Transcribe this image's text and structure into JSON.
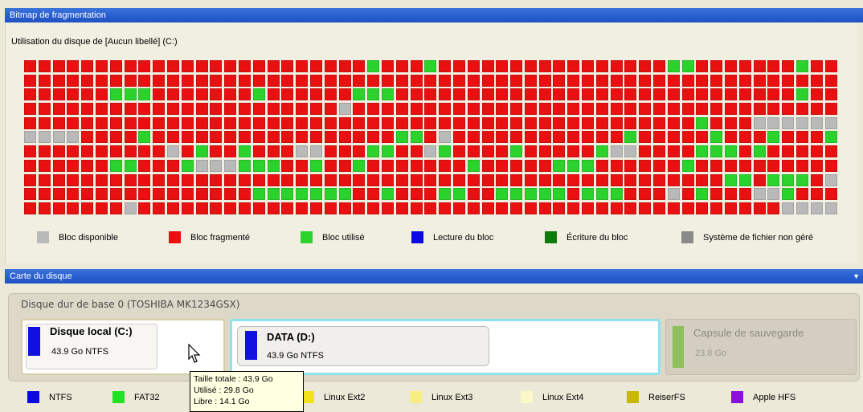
{
  "fragmentation_panel": {
    "title": "Bitmap de fragmentation",
    "disk_caption": "Utilisation du disque de [Aucun libellé] (C:)",
    "bitmap_rows": [
      "rrrrrrrrrrrrrrrrrrrrrrrrgrrrgrrrrrrrrrrrrrrrrggrrrrrrrgrrr",
      "rrrrrrrrrrrrrrrrrrrrrrrrrrrrrrrrrrrrrrrrrrrrrrrrrrrrrrrrr",
      "rrrrrrgggrrrrrrrgrrrrrrgggrrrrrrrrrrrrrrrrrrrrrrrrrrrrgrr",
      "rrrrrrrrrrrrrrrrrrrrrrarrrrrrrrrrrrrrrrrrrrrrrrrrrrrrrrrr",
      "rrrrrrrrrrrrrrrrrrrrrrrrrrrrrrrrrrrrrrrrrrrrrrrgrrraaaaaa",
      "aaaarrrrgrrrrrrrrrrrrrrrrrggrarrrrrrrrrrrrgrrrrrgrrrgrrrgg",
      "rrrrrrrrrrargrrgrrraarrrggrragrrrrgrrrrrgaarrrrgggrgrrrrrgg",
      "rrrrrrggrrrgaaagggrrgrrgrrrrrrrgrrrrrgggrrrrrrgrrrrrrrrrrgr",
      "rrrrrrrrrrrrrrrrrrrrrrrrrrrrrrrrrrrrrrrrrrrrrrrrrggrgggrarr",
      "rrrrrrrrrrrrrrrrgggggggrrgrrrggrrgggggrgggrrrargrrraagrrraa",
      "rrrrrrrarrrrrrrrrrrrrrrrrrrrrrrrrrrrrrrrrrrrrrrrrrrrraaaag"
    ],
    "legend": [
      {
        "label": "Bloc disponible",
        "color": "#b9b9b9"
      },
      {
        "label": "Bloc fragmenté",
        "color": "#e81010"
      },
      {
        "label": "Bloc utilisé",
        "color": "#2bd22b"
      },
      {
        "label": "Lecture du bloc",
        "color": "#0a0ae0"
      },
      {
        "label": "Écriture du bloc",
        "color": "#0c7a0c"
      },
      {
        "label": "Système de fichier non géré",
        "color": "#8a8a8a"
      }
    ]
  },
  "disk_map_panel": {
    "title": "Carte du disque",
    "basic_disk_label": "Disque dur de base 0 (TOSHIBA MK1234GSX)",
    "partitions": [
      {
        "name": "Disque local (C:)",
        "size": "43.9 Go NTFS",
        "color": "#1010e0"
      },
      {
        "name": "DATA (D:)",
        "size": "43.9 Go NTFS",
        "color": "#1010e0"
      },
      {
        "name": "Capsule de sauvegarde",
        "size": "23.8 Go",
        "color": "#8fbf5a"
      }
    ],
    "tooltip": {
      "total": "Taille totale : 43.9 Go",
      "used": "Utilisé : 29.8 Go",
      "free": "Libre : 14.1 Go"
    },
    "fs_legend": [
      {
        "label": "NTFS",
        "color": "#0a0ae0"
      },
      {
        "label": "FAT32",
        "color": "#22e022"
      },
      {
        "label": "Linux Ext2",
        "color": "#f2e21a"
      },
      {
        "label": "Linux Ext3",
        "color": "#f6ee80"
      },
      {
        "label": "Linux Ext4",
        "color": "#fbf8c8"
      },
      {
        "label": "ReiserFS",
        "color": "#c9b800"
      },
      {
        "label": "Apple HFS",
        "color": "#8a10e0"
      }
    ]
  }
}
